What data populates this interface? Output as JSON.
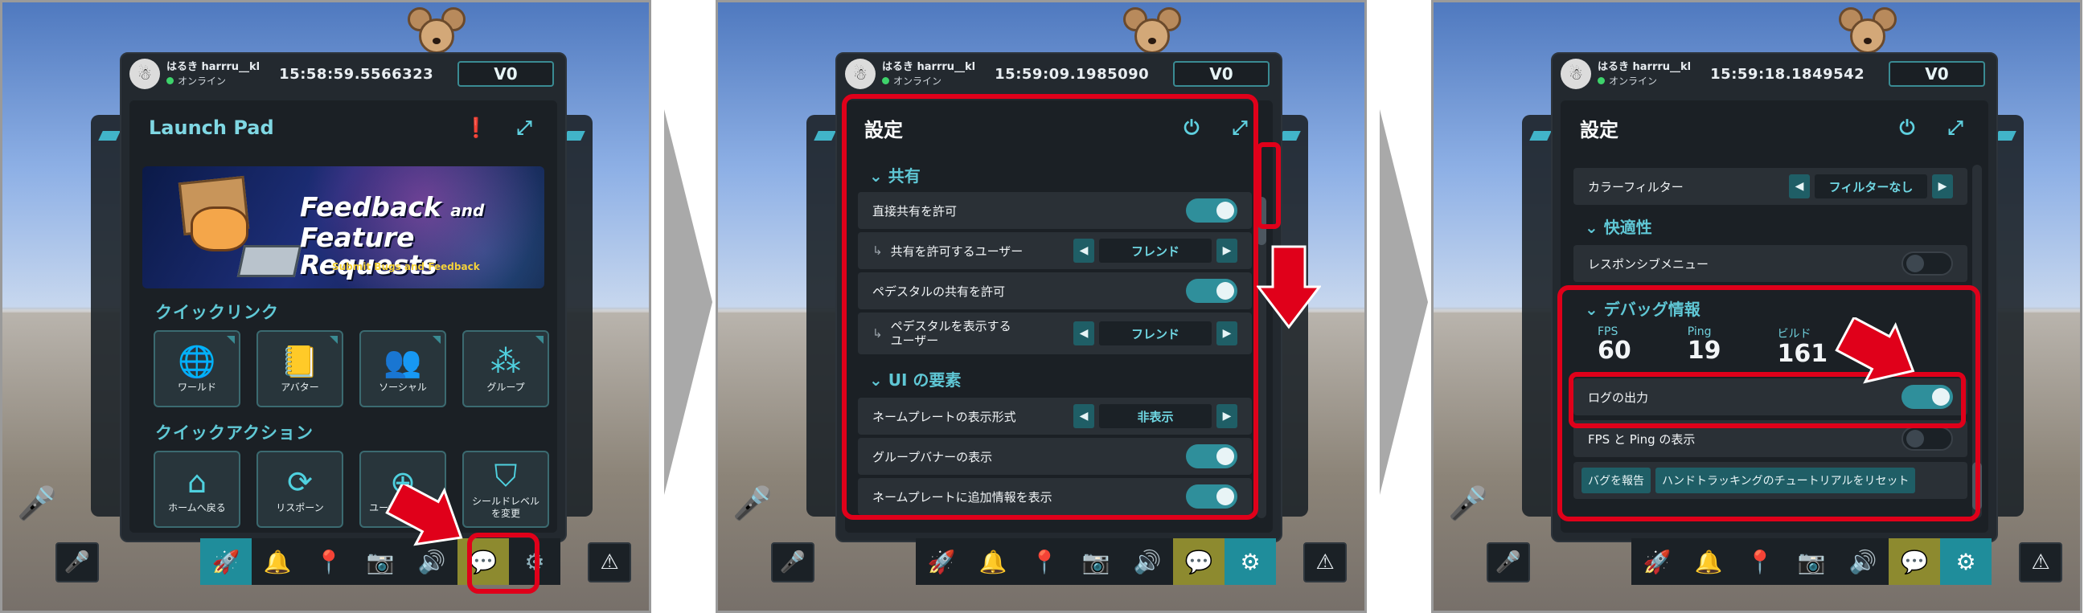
{
  "user": {
    "name": "はるき harrru__kl",
    "status": "オンライン",
    "vcoins": "V0"
  },
  "panel1": {
    "time": "15:58:59.5566323",
    "title": "Launch Pad",
    "banner": {
      "line1": "Feedback",
      "line1b": "and",
      "line2": "Feature Requests",
      "sub": "Submit Bugs and Feedback"
    },
    "quick_links_header": "クイックリンク",
    "quick_links": [
      {
        "label": "ワールド",
        "icon": "globe-icon"
      },
      {
        "label": "アバター",
        "icon": "avatar-book-icon"
      },
      {
        "label": "ソーシャル",
        "icon": "people-icon"
      },
      {
        "label": "グループ",
        "icon": "group-nodes-icon"
      }
    ],
    "quick_actions_header": "クイックアクション",
    "quick_actions": [
      {
        "label": "ホームへ戻る",
        "icon": "home-icon"
      },
      {
        "label": "リスポーン",
        "icon": "respawn-icon"
      },
      {
        "label": "ユーザーを選択",
        "icon": "crosshair-icon"
      },
      {
        "label": "シールドレベル\nを変更",
        "icon": "shield-icon"
      }
    ]
  },
  "panel2": {
    "time": "15:59:09.1985090",
    "title": "設定",
    "group_share": "共有",
    "rows_share": [
      {
        "label": "直接共有を許可",
        "type": "toggle",
        "on": true
      },
      {
        "label": "共有を許可するユーザー",
        "type": "selector",
        "value": "フレンド",
        "sub": true
      },
      {
        "label": "ペデスタルの共有を許可",
        "type": "toggle",
        "on": true
      },
      {
        "label": "ペデスタルを表示する\nユーザー",
        "type": "selector",
        "value": "フレンド",
        "sub": true
      }
    ],
    "group_ui": "UI の要素",
    "rows_ui": [
      {
        "label": "ネームプレートの表示形式",
        "type": "selector",
        "value": "非表示"
      },
      {
        "label": "グループバナーの表示",
        "type": "toggle",
        "on": true
      },
      {
        "label": "ネームプレートに追加情報を表示",
        "type": "toggle",
        "on": true
      }
    ]
  },
  "panel3": {
    "time": "15:59:18.1849542",
    "title": "設定",
    "row_color": {
      "label": "カラーフィルター",
      "value": "フィルターなし"
    },
    "group_comfort": "快適性",
    "row_responsive": {
      "label": "レスポンシブメニュー",
      "on": false
    },
    "group_debug": "デバッグ情報",
    "stats": [
      {
        "label": "FPS",
        "value": "60"
      },
      {
        "label": "Ping",
        "value": "19"
      },
      {
        "label": "ビルド",
        "value": "161"
      }
    ],
    "row_log": {
      "label": "ログの出力",
      "on": true
    },
    "row_fps": {
      "label": "FPS と Ping の表示",
      "on": false
    },
    "btn_bug": "バグを報告",
    "btn_reset": "ハンドトラッキングのチュートリアルをリセット"
  },
  "dock": {
    "icons": [
      "rocket-icon",
      "bell-icon",
      "location-pin-icon",
      "camera-icon",
      "speaker-icon",
      "chat-icon",
      "gear-icon"
    ],
    "left_icon": "mic-muted-icon",
    "right_icon": "warning-icon"
  },
  "colors": {
    "highlight": "#e0001a",
    "accent": "#5fc7d5",
    "panel": "#23292f"
  }
}
